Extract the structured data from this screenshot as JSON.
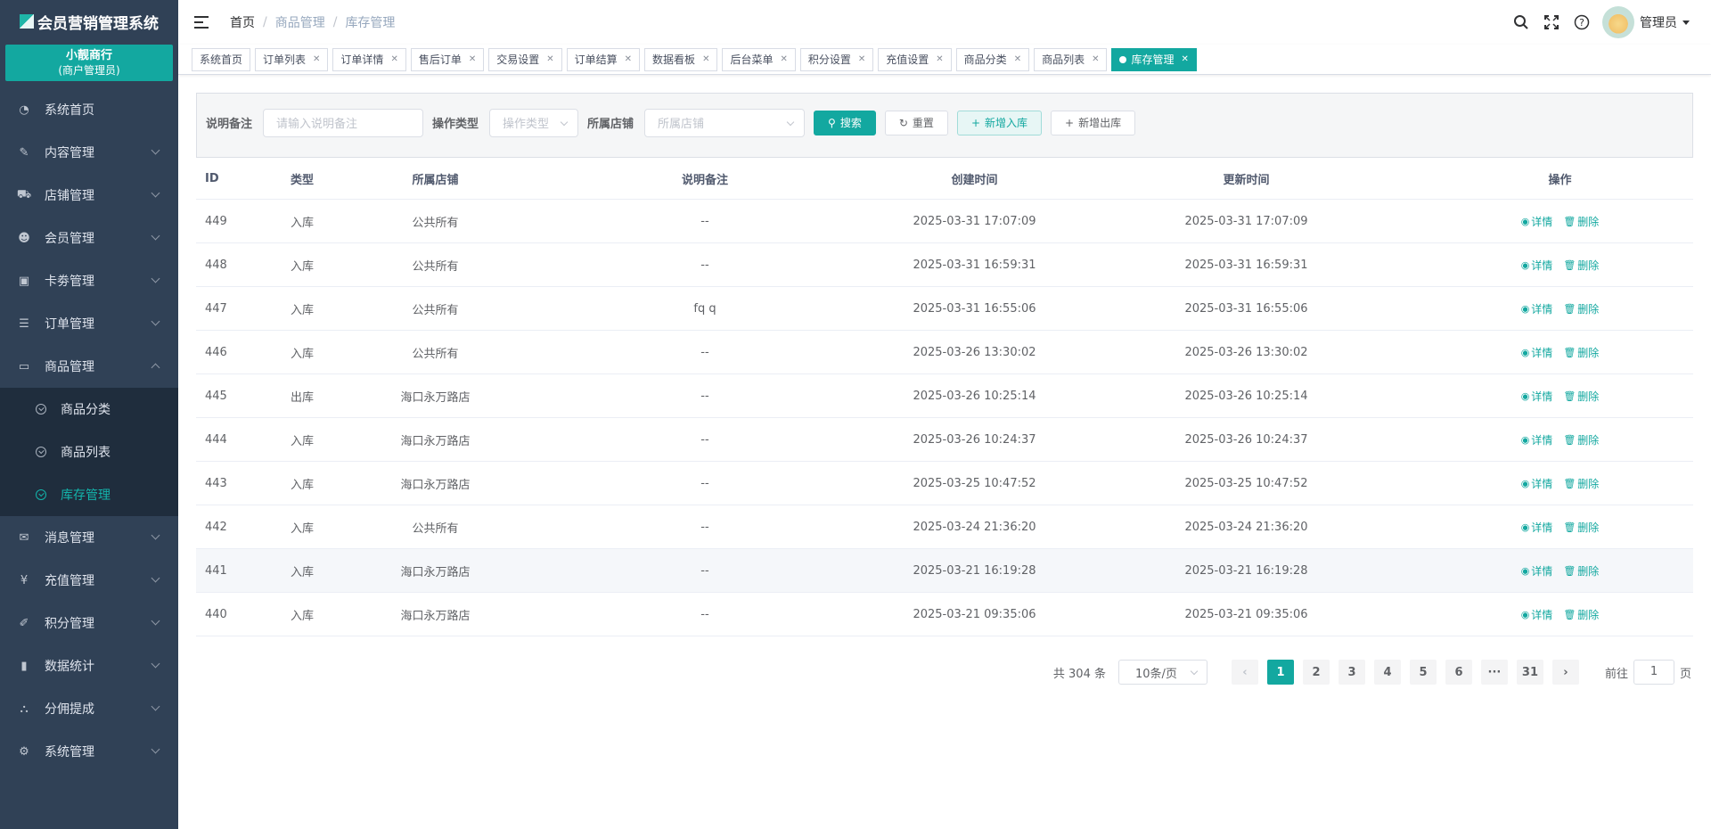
{
  "app": {
    "title": "会员营销管理系统"
  },
  "shop": {
    "name": "小靓商行",
    "role": "(商户管理员)"
  },
  "sidebar": {
    "items": [
      {
        "label": "系统首页",
        "icon": "dashboard-icon"
      },
      {
        "label": "内容管理",
        "icon": "edit-icon"
      },
      {
        "label": "店铺管理",
        "icon": "cart-icon"
      },
      {
        "label": "会员管理",
        "icon": "users-icon"
      },
      {
        "label": "卡劵管理",
        "icon": "card-icon"
      },
      {
        "label": "订单管理",
        "icon": "list-icon"
      },
      {
        "label": "商品管理",
        "icon": "goods-icon"
      },
      {
        "label": "消息管理",
        "icon": "message-icon"
      },
      {
        "label": "充值管理",
        "icon": "yen-icon"
      },
      {
        "label": "积分管理",
        "icon": "points-icon"
      },
      {
        "label": "数据统计",
        "icon": "chart-icon"
      },
      {
        "label": "分佣提成",
        "icon": "org-icon"
      },
      {
        "label": "系统管理",
        "icon": "gear-icon"
      }
    ],
    "submenu": [
      {
        "label": "商品分类"
      },
      {
        "label": "商品列表"
      },
      {
        "label": "库存管理"
      }
    ]
  },
  "breadcrumb": [
    "首页",
    "商品管理",
    "库存管理"
  ],
  "header": {
    "admin": "管理员"
  },
  "tags": [
    "系统首页",
    "订单列表",
    "订单详情",
    "售后订单",
    "交易设置",
    "订单结算",
    "数据看板",
    "后台菜单",
    "积分设置",
    "充值设置",
    "商品分类",
    "商品列表",
    "库存管理"
  ],
  "filter": {
    "note_label": "说明备注",
    "note_placeholder": "请输入说明备注",
    "type_label": "操作类型",
    "type_placeholder": "操作类型",
    "store_label": "所属店铺",
    "store_placeholder": "所属店铺",
    "search": "搜索",
    "reset": "重置",
    "add_in": "新增入库",
    "add_out": "新增出库"
  },
  "table": {
    "headers": [
      "ID",
      "类型",
      "所属店铺",
      "说明备注",
      "创建时间",
      "更新时间",
      "操作"
    ],
    "detail": "详情",
    "delete": "删除",
    "rows": [
      [
        "449",
        "入库",
        "公共所有",
        "--",
        "2025-03-31 17:07:09",
        "2025-03-31 17:07:09"
      ],
      [
        "448",
        "入库",
        "公共所有",
        "--",
        "2025-03-31 16:59:31",
        "2025-03-31 16:59:31"
      ],
      [
        "447",
        "入库",
        "公共所有",
        "fq q",
        "2025-03-31 16:55:06",
        "2025-03-31 16:55:06"
      ],
      [
        "446",
        "入库",
        "公共所有",
        "--",
        "2025-03-26 13:30:02",
        "2025-03-26 13:30:02"
      ],
      [
        "445",
        "出库",
        "海口永万路店",
        "--",
        "2025-03-26 10:25:14",
        "2025-03-26 10:25:14"
      ],
      [
        "444",
        "入库",
        "海口永万路店",
        "--",
        "2025-03-26 10:24:37",
        "2025-03-26 10:24:37"
      ],
      [
        "443",
        "入库",
        "海口永万路店",
        "--",
        "2025-03-25 10:47:52",
        "2025-03-25 10:47:52"
      ],
      [
        "442",
        "入库",
        "公共所有",
        "--",
        "2025-03-24 21:36:20",
        "2025-03-24 21:36:20"
      ],
      [
        "441",
        "入库",
        "海口永万路店",
        "--",
        "2025-03-21 16:19:28",
        "2025-03-21 16:19:28"
      ],
      [
        "440",
        "入库",
        "海口永万路店",
        "--",
        "2025-03-21 09:35:06",
        "2025-03-21 09:35:06"
      ]
    ]
  },
  "pagination": {
    "total": "共 304 条",
    "page_size": "10条/页",
    "pages": [
      "1",
      "2",
      "3",
      "4",
      "5",
      "6",
      "···",
      "31"
    ],
    "current": "1",
    "goto_prefix": "前往",
    "goto_value": "1",
    "goto_suffix": "页"
  },
  "colors": {
    "accent": "#13a8a0",
    "sidebar_bg": "#304156",
    "submenu_bg": "#1f2d3d"
  }
}
